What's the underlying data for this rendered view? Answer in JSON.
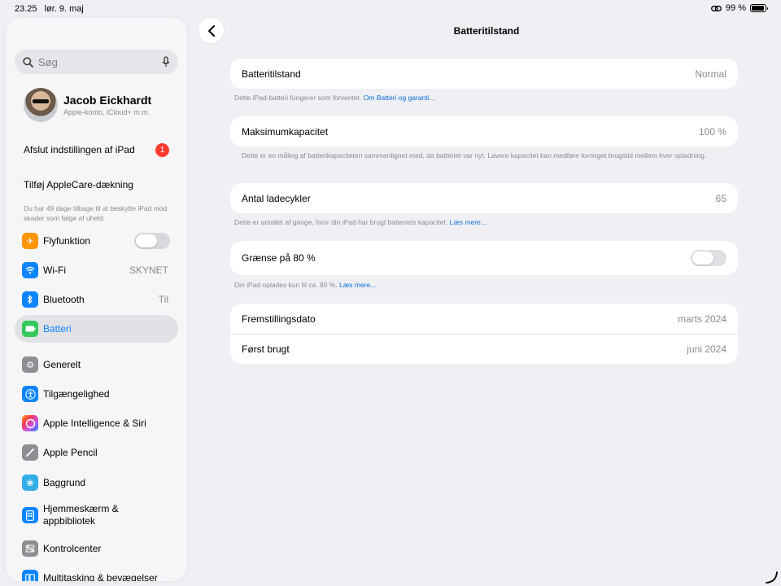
{
  "status": {
    "time": "23.25",
    "date": "lør. 9. maj",
    "battery": "99 %"
  },
  "sidebar": {
    "search_placeholder": "Søg",
    "profile": {
      "name": "Jacob Eickhardt",
      "subtitle": "Apple-konto, iCloud+ m.m."
    },
    "finish_setup": "Afslut indstillingen af iPad",
    "badge": "1",
    "applecare": "Tilføj AppleCare-dækning",
    "applecare_note": "Du har 49 dage tilbage til at beskytte iPad mod skader som følge af uheld.",
    "items": [
      {
        "label": "Flyfunktion",
        "icon": "airplane-icon",
        "color": "#ff9500"
      },
      {
        "label": "Wi-Fi",
        "value": "SKYNET",
        "icon": "wifi-icon",
        "color": "#0a84ff"
      },
      {
        "label": "Bluetooth",
        "value": "Til",
        "icon": "bluetooth-icon",
        "color": "#0a84ff"
      },
      {
        "label": "Batteri",
        "icon": "battery-icon",
        "color": "#34c759"
      },
      {
        "label": "Generelt",
        "icon": "gear-icon",
        "color": "#8e8e93"
      },
      {
        "label": "Tilgængelighed",
        "icon": "accessibility-icon",
        "color": "#0a84ff"
      },
      {
        "label": "Apple Intelligence & Siri",
        "icon": "siri-icon",
        "color": "#d06bd8"
      },
      {
        "label": "Apple Pencil",
        "icon": "pencil-icon",
        "color": "#8e8e93"
      },
      {
        "label": "Baggrund",
        "icon": "wallpaper-icon",
        "color": "#32ade6"
      },
      {
        "label": "Hjemmeskærm &",
        "label2": "appbibliotek",
        "icon": "homescreen-icon",
        "color": "#0a84ff"
      },
      {
        "label": "Kontrolcenter",
        "icon": "control-center-icon",
        "color": "#8e8e93"
      },
      {
        "label": "Multitasking & bevægelser",
        "icon": "multitasking-icon",
        "color": "#0a84ff"
      }
    ]
  },
  "main": {
    "title": "Batteritilstand",
    "health": {
      "label": "Batteritilstand",
      "value": "Normal",
      "footer": "Dette iPad-batteri fungerer som forventet.",
      "link": "Om Batteri og garanti..."
    },
    "capacity": {
      "label": "Maksimumkapacitet",
      "value": "100 %",
      "footer": "Dette er en måling af batterikapaciteten sammenlignet med, da batteriet var nyt. Lavere kapacitet kan medføre forringet brugstid mellem hver opladning."
    },
    "cycles": {
      "label": "Antal ladecykler",
      "value": "65",
      "footer": "Dette er antallet af gange, hvor din iPad har brugt batteriets kapacitet.",
      "link": "Læs mere..."
    },
    "limit": {
      "label": "Grænse på 80 %",
      "footer": "Din iPad oplades kun til ca. 80 %.",
      "link": "Læs mere..."
    },
    "manufacture": {
      "label": "Fremstillingsdato",
      "value": "marts 2024"
    },
    "first_use": {
      "label": "Først brugt",
      "value": "juni 2024"
    }
  }
}
